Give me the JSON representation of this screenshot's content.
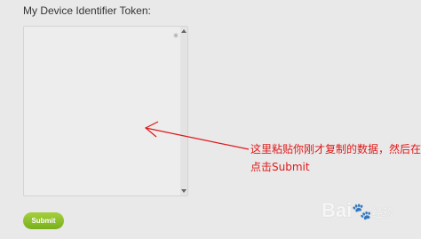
{
  "form": {
    "label": "My Device Identifier Token:",
    "required_marker": "*",
    "textarea_value": "",
    "submit_label": "Submit"
  },
  "annotation": {
    "line1": "这里粘贴你刚才复制的数据，然后在",
    "line2": "点击Submit",
    "color": "#e01818"
  },
  "watermark": {
    "text": "Bai",
    "paw": "🐾",
    "suffix": "经验"
  },
  "colors": {
    "background": "#e9e9e9",
    "button_green": "#8cc22c",
    "annotation_red": "#e01818"
  }
}
